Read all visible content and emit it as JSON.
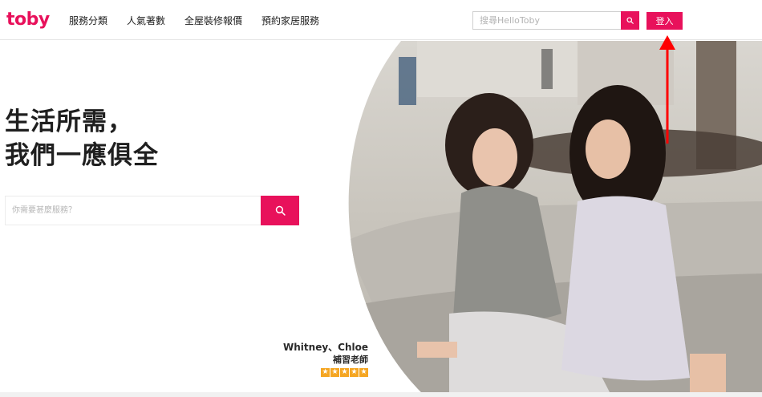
{
  "brand": {
    "logo_text": "toby",
    "accent_color": "#e8115b"
  },
  "nav": {
    "items": [
      {
        "label": "服務分類"
      },
      {
        "label": "人氣著數"
      },
      {
        "label": "全屋裝修報價"
      },
      {
        "label": "預約家居服務"
      }
    ]
  },
  "header_search": {
    "placeholder": "搜尋HelloToby",
    "icon": "search-icon"
  },
  "login": {
    "label": "登入"
  },
  "hero": {
    "title_line1": "生活所需，",
    "title_line2": "我們一應俱全",
    "search_placeholder": "你需要甚麼服務？",
    "search_icon": "search-icon"
  },
  "testimonial": {
    "name": "Whitney、Chloe",
    "role": "補習老師",
    "rating": 5,
    "star_color": "#f5a623"
  },
  "annotation": {
    "arrow_color": "#ff0000",
    "points_to": "login-button"
  }
}
